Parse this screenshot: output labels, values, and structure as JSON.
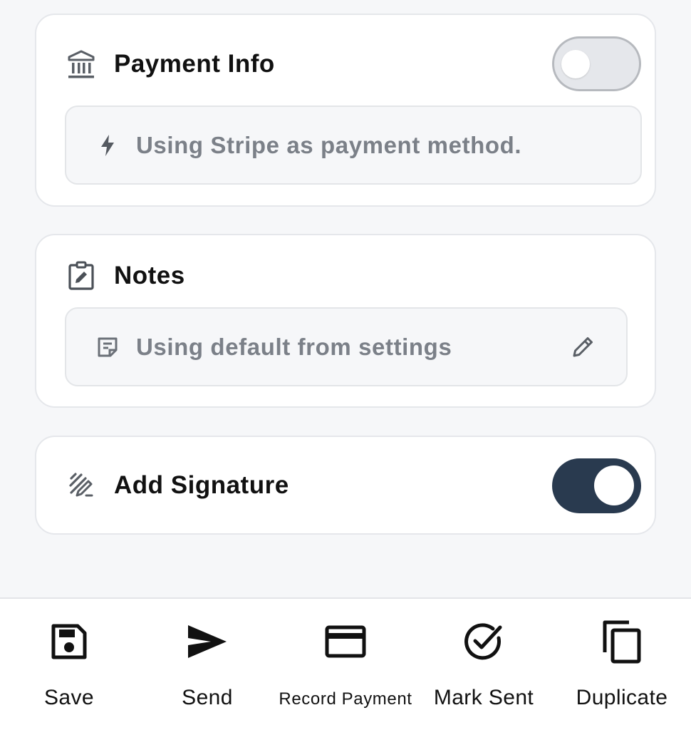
{
  "payment_info": {
    "title": "Payment Info",
    "icon": "bank-icon",
    "enabled": false,
    "message": "Using Stripe as payment method."
  },
  "notes": {
    "title": "Notes",
    "icon": "clipboard-edit-icon",
    "message": "Using default from settings"
  },
  "signature": {
    "title": "Add Signature",
    "icon": "signature-icon",
    "enabled": true
  },
  "actions": [
    {
      "label": "Save",
      "icon": "save-icon"
    },
    {
      "label": "Send",
      "icon": "send-icon"
    },
    {
      "label": "Record Payment",
      "icon": "credit-card-icon"
    },
    {
      "label": "Mark Sent",
      "icon": "check-circle-icon"
    },
    {
      "label": "Duplicate",
      "icon": "copy-icon"
    }
  ],
  "colors": {
    "toggle_on": "#293a4f",
    "toggle_off": "#e5e7eb",
    "muted_text": "#7b8088",
    "card_border": "#e5e7eb"
  }
}
